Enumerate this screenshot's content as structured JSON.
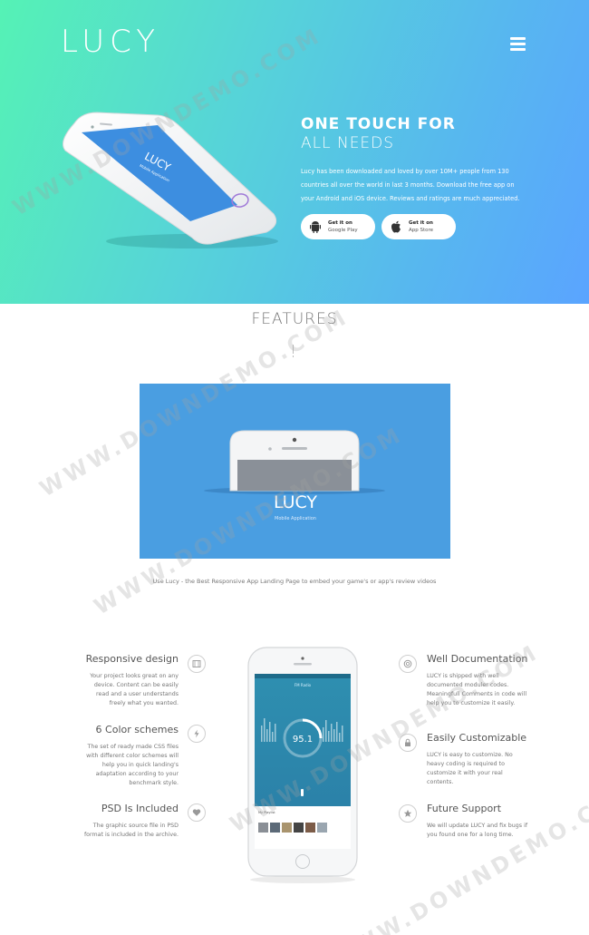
{
  "brand": {
    "logo": "LUCY"
  },
  "hero": {
    "title_line1": "ONE TOUCH FOR",
    "title_line2": "ALL NEEDS",
    "description": "Lucy has been downloaded and loved by over 10M+ people from 130 countries all over the world in last 3 months. Download the free app on your Android and iOS device. Reviews and ratings are much appreciated.",
    "phone_screen_title": "LUCY",
    "phone_screen_subtitle": "Mobile Application",
    "google_play": {
      "line1": "Get it on",
      "line2": "Google Play",
      "icon": "android-icon"
    },
    "app_store": {
      "line1": "Get it on",
      "line2": "App Store",
      "icon": "apple-icon"
    }
  },
  "features": {
    "title": "FEATURES",
    "video": {
      "title": "LUCY",
      "subtitle": "Mobile Application"
    },
    "caption": "Use Lucy - the Best Responsive App Landing Page to embed your game's or app's review videos",
    "left": [
      {
        "title": "Responsive design",
        "desc": "Your project looks great on any device. Content can be easily read and a user understands freely what you wanted.",
        "icon": "film-icon"
      },
      {
        "title": "6 Color schemes",
        "desc": "The set of ready made CSS files with different color schemes will help you in quick landing's adaptation according to your benchmark style.",
        "icon": "bolt-icon"
      },
      {
        "title": "PSD Is Included",
        "desc": "The graphic source file in PSD format is included in the archive.",
        "icon": "heart-icon"
      }
    ],
    "right": [
      {
        "title": "Well Documentation",
        "desc": "LUCY is shipped with well documented moduler codes. Meaningfull Comments in code will help you to customize it easily.",
        "icon": "lifebuoy-icon"
      },
      {
        "title": "Easily Customizable",
        "desc": "LUCY is easy to customize. No heavy coding is required to customize it with your real contents.",
        "icon": "lock-icon"
      },
      {
        "title": "Future Support",
        "desc": "We will update LUCY and fix bugs if you found one for a long time.",
        "icon": "star-icon"
      }
    ],
    "phone_app": {
      "value": "95.1",
      "header": "FM Radio",
      "list_title": "My Playlist"
    }
  },
  "watermark": "WWW.DOWNDEMO.COM",
  "colors": {
    "hero_start": "#55f2b5",
    "hero_end": "#5aa4ff",
    "video_bg": "#4a9ee1"
  }
}
